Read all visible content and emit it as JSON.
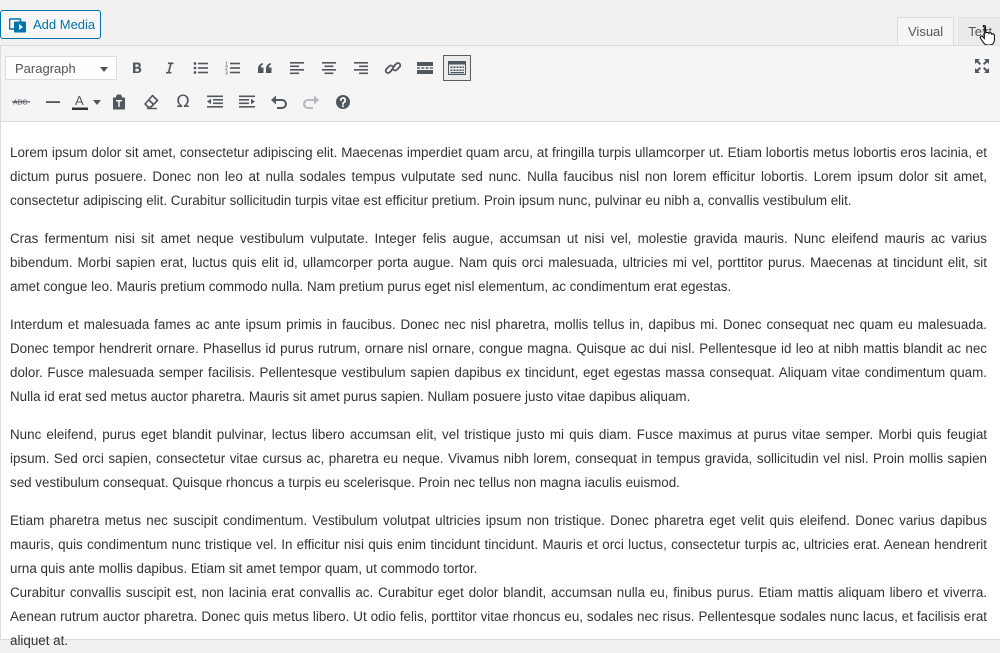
{
  "media_button": {
    "label": "Add Media",
    "icon": "media-icon"
  },
  "tabs": [
    {
      "label": "Visual",
      "active": true
    },
    {
      "label": "Text",
      "active": false
    }
  ],
  "toolbar": {
    "format_select": "Paragraph",
    "row1_icons": [
      "bold-icon",
      "italic-icon",
      "bullet-list-icon",
      "numbered-list-icon",
      "blockquote-icon",
      "align-left-icon",
      "align-center-icon",
      "align-right-icon",
      "link-icon",
      "read-more-icon",
      "toolbar-toggle-icon"
    ],
    "row2_icons": [
      "strikethrough-icon",
      "horizontal-line-icon",
      "text-color-icon",
      "paste-text-icon",
      "clear-formatting-icon",
      "special-character-icon",
      "outdent-icon",
      "indent-icon",
      "undo-icon",
      "redo-icon",
      "help-icon"
    ],
    "fullscreen_icon": "fullscreen-icon",
    "strike_label": "ABC",
    "text_color_label": "A",
    "text_color": "#333333",
    "omega": "Ω"
  },
  "content": {
    "paragraphs": [
      "Lorem ipsum dolor sit amet, consectetur adipiscing elit. Maecenas imperdiet quam arcu, at fringilla turpis ullamcorper ut. Etiam lobortis metus lobortis eros lacinia, et dictum purus posuere. Donec non leo at nulla sodales tempus vulputate sed nunc. Nulla faucibus nisl non lorem efficitur lobortis. Lorem ipsum dolor sit amet, consectetur adipiscing elit. Curabitur sollicitudin turpis vitae est efficitur pretium. Proin ipsum nunc, pulvinar eu nibh a, convallis vestibulum elit.",
      "Cras fermentum nisi sit amet neque vestibulum vulputate. Integer felis augue, accumsan ut nisi vel, molestie gravida mauris. Nunc eleifend mauris ac varius bibendum. Morbi sapien erat, luctus quis elit id, ullamcorper porta augue. Nam quis orci malesuada, ultricies mi vel, porttitor purus. Maecenas at tincidunt elit, sit amet congue leo. Mauris pretium commodo nulla. Nam pretium purus eget nisl elementum, ac condimentum erat egestas.",
      "Interdum et malesuada fames ac ante ipsum primis in faucibus. Donec nec nisl pharetra, mollis tellus in, dapibus mi. Donec consequat nec quam eu malesuada. Donec tempor hendrerit ornare. Phasellus id purus rutrum, ornare nisl ornare, congue magna. Quisque ac dui nisl. Pellentesque id leo at nibh mattis blandit ac nec dolor. Fusce malesuada semper facilisis. Pellentesque vestibulum sapien dapibus ex tincidunt, eget egestas massa consequat. Aliquam vitae condimentum quam. Nulla id erat sed metus auctor pharetra. Mauris sit amet purus sapien. Nullam posuere justo vitae dapibus aliquam.",
      "Nunc eleifend, purus eget blandit pulvinar, lectus libero accumsan elit, vel tristique justo mi quis diam. Fusce maximus at purus vitae semper. Morbi quis feugiat ipsum. Sed orci sapien, consectetur vitae cursus ac, pharetra eu neque. Vivamus nibh lorem, consequat in tempus gravida, sollicitudin vel nisl. Proin mollis sapien sed vestibulum consequat. Quisque rhoncus a turpis eu scelerisque. Proin nec tellus non magna iaculis euismod.",
      "Etiam pharetra metus nec suscipit condimentum. Vestibulum volutpat ultricies ipsum non tristique. Donec pharetra eget velit quis eleifend. Donec varius dapibus mauris, quis condimentum nunc tristique vel. In efficitur nisi quis enim tincidunt tincidunt. Mauris et orci luctus, consectetur turpis ac, ultricies erat. Aenean hendrerit urna quis ante mollis dapibus. Etiam sit amet tempor quam, ut commodo tortor.",
      "Curabitur convallis suscipit est, non lacinia erat convallis ac. Curabitur eget dolor blandit, accumsan nulla eu, finibus purus. Etiam mattis aliquam libero et viverra. Aenean rutrum auctor pharetra. Donec quis metus libero. Ut odio felis, porttitor vitae rhoncus eu, sodales nec risus. Pellentesque sodales nunc lacus, et facilisis erat aliquet at."
    ]
  }
}
